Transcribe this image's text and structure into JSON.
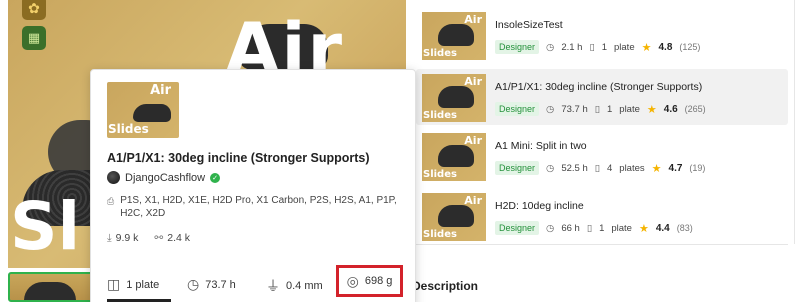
{
  "popup": {
    "title": "A1/P1/X1: 30deg incline (Stronger Supports)",
    "author": "DjangoCashflow",
    "printers": "P1S, X1, H2D, X1E, H2D Pro, X1 Carbon, P2S, H2S, A1, P1P, H2C, X2D",
    "downloads": "9.9 k",
    "boosts": "2.4 k",
    "thumb_text_top": "Air",
    "thumb_text_bottom": "Slides",
    "stats": {
      "plates": "1 plate",
      "time": "73.7 h",
      "nozzle": "0.4 mm",
      "weight": "698 g"
    }
  },
  "hero": {
    "text_top": "Air",
    "text_bottom": "Sl"
  },
  "list": [
    {
      "title": "InsoleSizeTest",
      "tag": "Designer",
      "time": "2.1 h",
      "plates_num": "1",
      "plates_word": "plate",
      "rating": "4.8",
      "count": "(125)",
      "active": false
    },
    {
      "title": "A1/P1/X1: 30deg incline (Stronger Supports)",
      "tag": "Designer",
      "time": "73.7 h",
      "plates_num": "1",
      "plates_word": "plate",
      "rating": "4.6",
      "count": "(265)",
      "active": true
    },
    {
      "title": "A1 Mini: Split in two",
      "tag": "Designer",
      "time": "52.5 h",
      "plates_num": "4",
      "plates_word": "plates",
      "rating": "4.7",
      "count": "(19)",
      "active": false
    },
    {
      "title": "H2D: 10deg incline",
      "tag": "Designer",
      "time": "66 h",
      "plates_num": "1",
      "plates_word": "plate",
      "rating": "4.4",
      "count": "(83)",
      "active": false
    }
  ],
  "list_thumb_text": {
    "top": "Air",
    "bottom": "Slides"
  },
  "description_label": "Description",
  "colors": {
    "accent_green": "#2fb24c",
    "highlight_red": "#d3222a",
    "star": "#f5b400"
  },
  "icons": [
    "plate-icon",
    "clock-icon",
    "nozzle-icon",
    "filament-icon",
    "download-icon",
    "boost-icon",
    "star-icon",
    "verified-icon",
    "printer-icon"
  ]
}
